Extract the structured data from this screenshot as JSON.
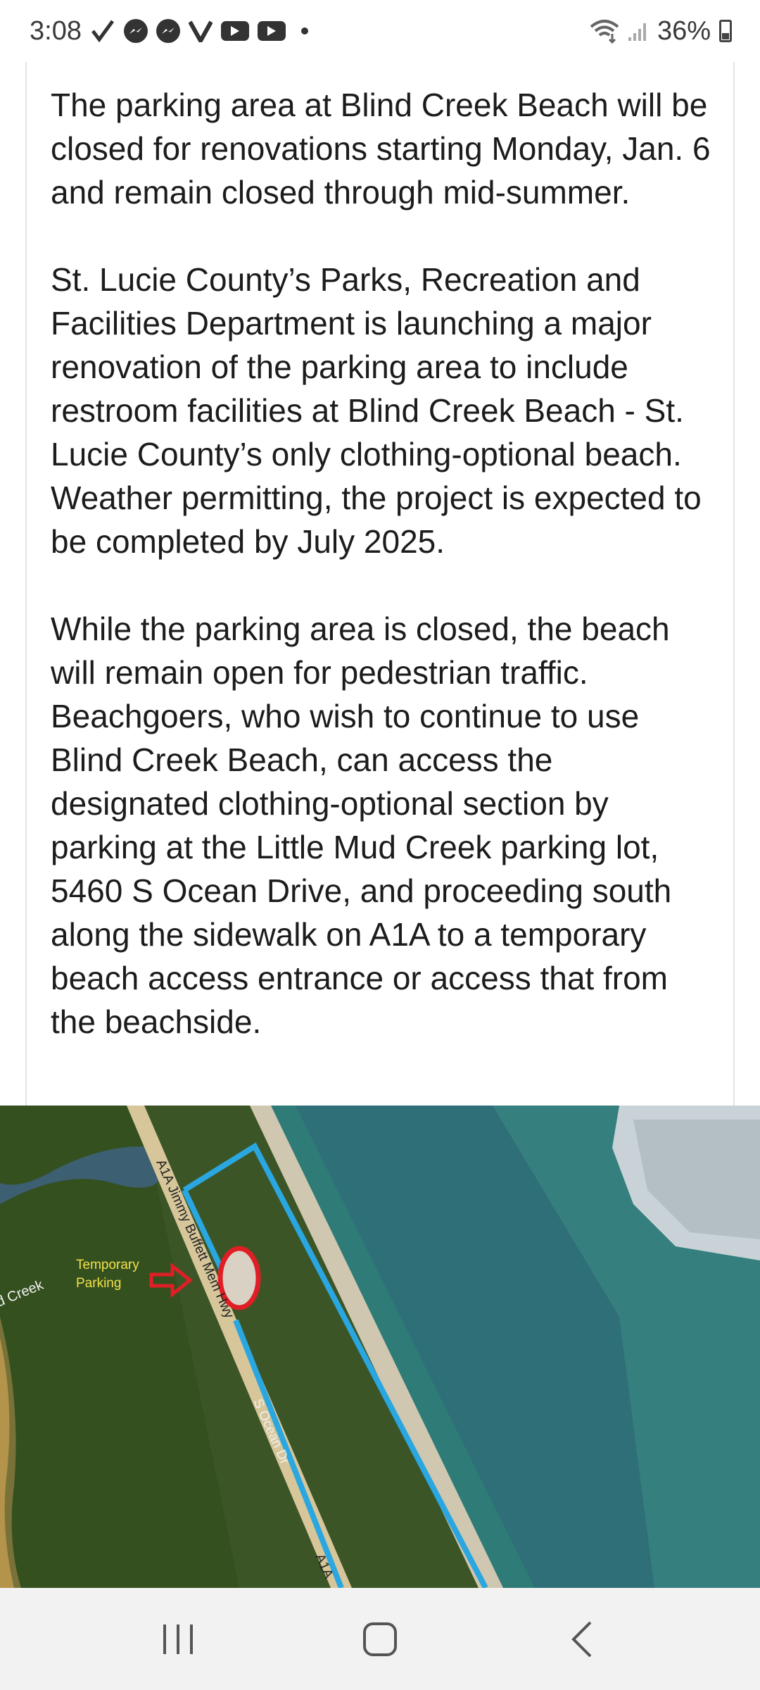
{
  "status_bar": {
    "time": "3:08",
    "notification_icons": [
      "check-icon",
      "messenger-icon",
      "messenger-icon",
      "v-icon",
      "youtube-icon",
      "youtube-icon",
      "dot-icon"
    ],
    "battery": "36%"
  },
  "article": {
    "paragraphs": [
      "The parking area at Blind Creek Beach will be closed for renovations starting Monday, Jan. 6 and remain closed through mid-summer.",
      "St. Lucie County’s Parks, Recreation and Facilities Department is launching a major renovation of the parking area to include restroom facilities at Blind Creek Beach - St. Lucie County’s only clothing-optional beach. Weather permitting, the project is expected to be completed by July 2025.",
      "While the parking area is closed, the beach will remain open for pedestrian traffic. Beachgoers, who wish to continue to use Blind Creek Beach, can access the designated clothing-optional section by parking at the Little Mud Creek parking lot, 5460 S Ocean Drive, and proceeding south along the sidewalk on A1A to a temporary beach access entrance or access that from the beachside."
    ]
  },
  "map": {
    "labels": {
      "creek": "Mud Creek",
      "temporary_parking_line1": "Temporary",
      "temporary_parking_line2": "Parking",
      "road_main": "A1A Jimmy Buffett Mem Hwy",
      "road_ocean": "S Ocean Dr",
      "road_lower": "A1A"
    },
    "colors": {
      "route": "#2aa6e0",
      "marker": "#e01e26",
      "label": "#f2e04a",
      "ocean": "#2f7f7a",
      "land": "#3f5a2a",
      "road": "#d9c99a"
    }
  },
  "nav_bar": {
    "buttons": [
      "recent-apps",
      "home",
      "back"
    ]
  }
}
